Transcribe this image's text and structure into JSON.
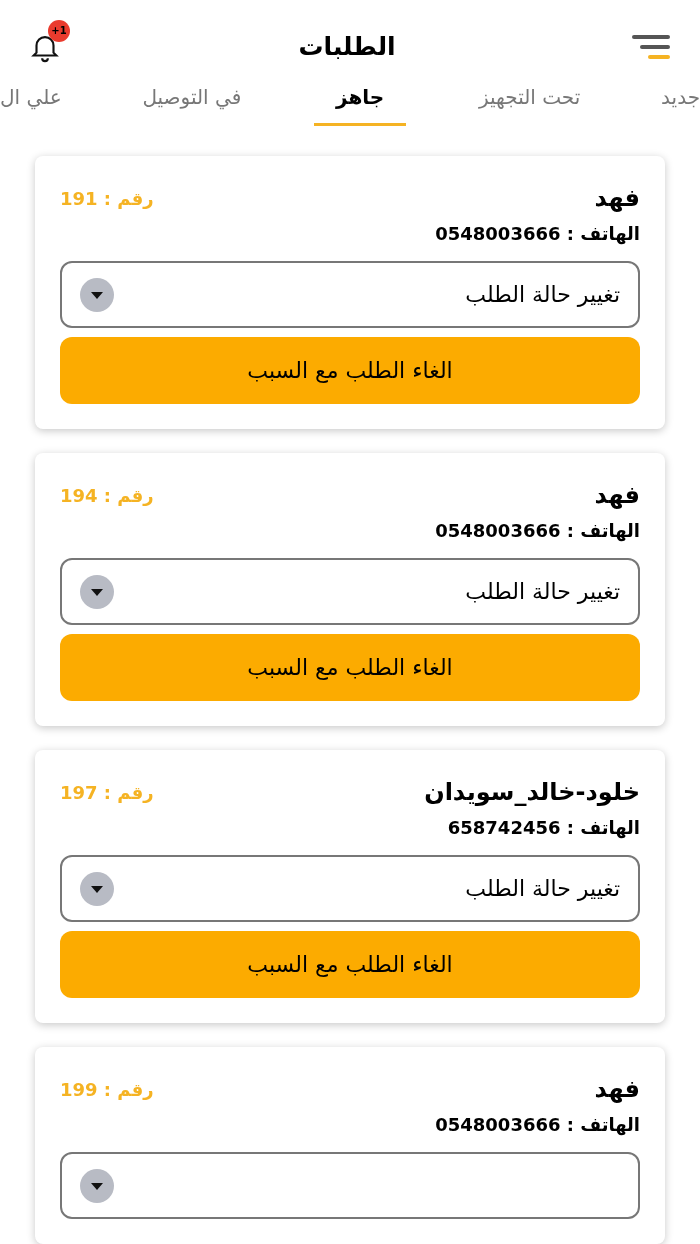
{
  "header": {
    "title": "الطلبات",
    "notification_badge": "+1"
  },
  "tabs": [
    {
      "label": "جديد",
      "selected": false
    },
    {
      "label": "تحت التجهيز",
      "selected": false
    },
    {
      "label": "جاهز",
      "selected": true
    },
    {
      "label": "في التوصيل",
      "selected": false
    },
    {
      "label": "علي ال",
      "selected": false
    }
  ],
  "orders": [
    {
      "name": "فهد",
      "number": "رقم : 191",
      "phone": "الهاتف : 0548003666",
      "status_dropdown": "تغيير حالة الطلب",
      "cancel_button": "الغاء الطلب مع السبب"
    },
    {
      "name": "فهد",
      "number": "رقم : 194",
      "phone": "الهاتف : 0548003666",
      "status_dropdown": "تغيير حالة الطلب",
      "cancel_button": "الغاء الطلب مع السبب"
    },
    {
      "name": "خلود-خالد_سويدان",
      "number": "رقم : 197",
      "phone": "الهاتف : 658742456",
      "status_dropdown": "تغيير حالة الطلب",
      "cancel_button": "الغاء الطلب مع السبب"
    },
    {
      "name": "فهد",
      "number": "رقم : 199",
      "phone": "الهاتف : 0548003666"
    }
  ]
}
